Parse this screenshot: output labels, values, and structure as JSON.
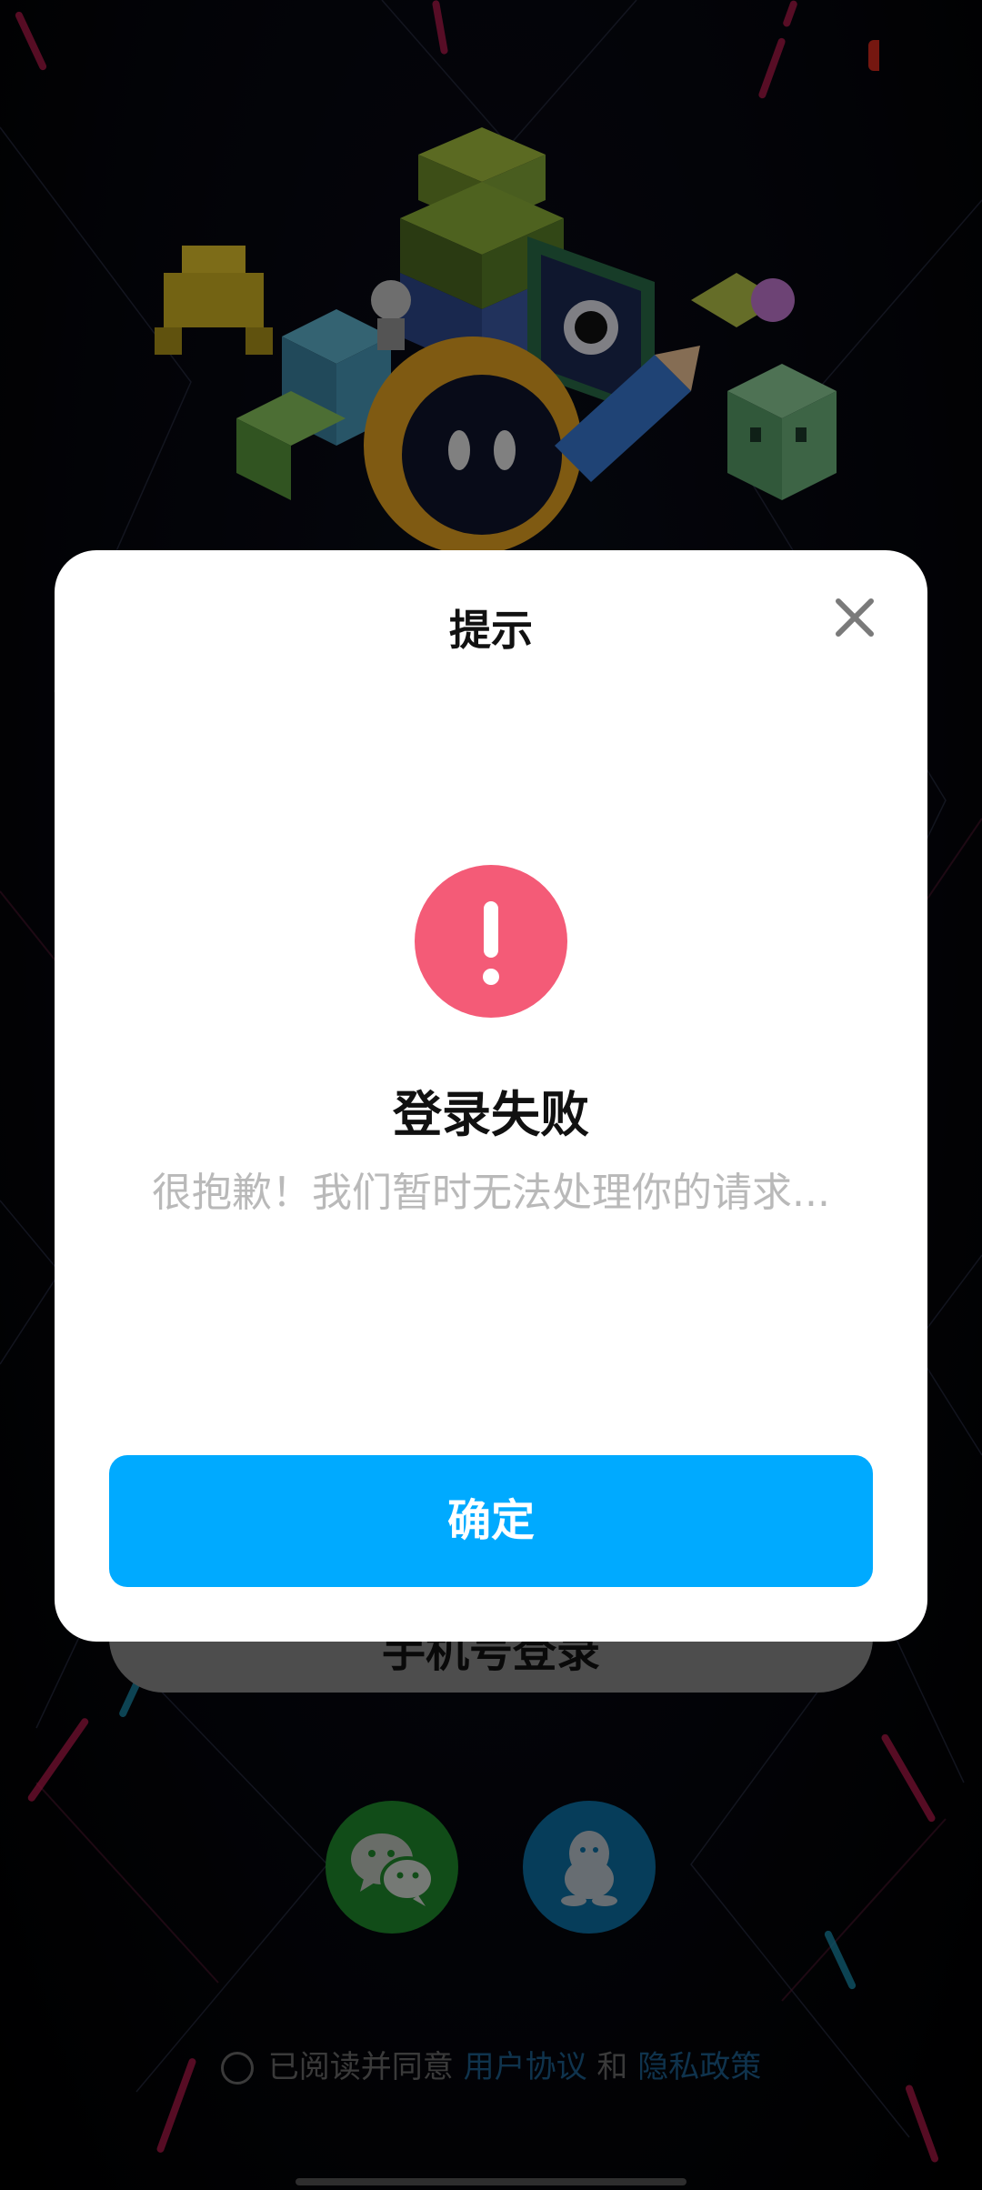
{
  "dialog": {
    "title": "提示",
    "status_title": "登录失败",
    "message": "很抱歉！我们暂时无法处理你的请求...",
    "confirm_label": "确定",
    "close_icon": "close-icon",
    "alert_icon": "exclamation-icon",
    "alert_color": "#f45b77",
    "confirm_color": "#00aaff"
  },
  "login": {
    "phone_login_label": "手机号登录",
    "wechat_icon": "wechat-icon",
    "qq_icon": "qq-icon"
  },
  "agreement": {
    "prefix": "已阅读并同意",
    "user_agreement": "用户协议",
    "conjunction": "和",
    "privacy_policy": "隐私政策"
  }
}
